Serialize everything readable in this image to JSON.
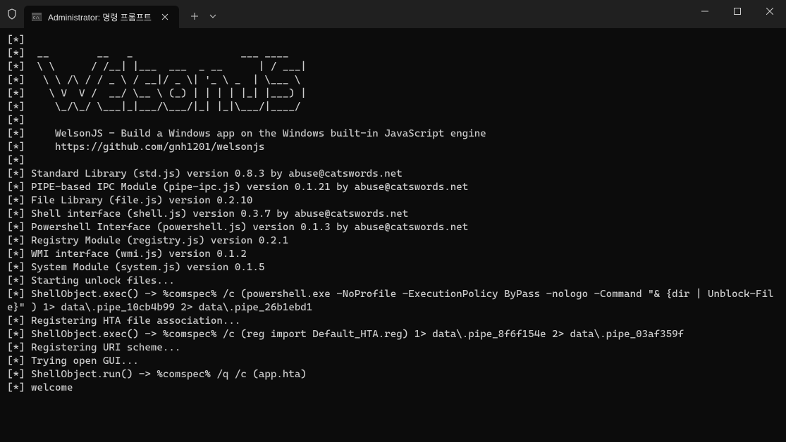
{
  "window": {
    "tab_title": "Administrator: 명령 프롬프트"
  },
  "terminal": {
    "lines": [
      "[*]",
      "[*]  __        __   _                  ___ ____",
      "[*]  \\ \\      / /__| |___  ___  _ __      | / ___|",
      "[*]   \\ \\ /\\ / / _ \\ / __|/ _ \\| '_ \\ _  | \\___ \\",
      "[*]    \\ V  V /  __/ \\__ \\ (_) | | | | |_| |___) |",
      "[*]     \\_/\\_/ \\___|_|___/\\___/|_| |_|\\___/|____/",
      "[*]",
      "[*]     WelsonJS - Build a Windows app on the Windows built-in JavaScript engine",
      "[*]     https://github.com/gnh1201/welsonjs",
      "[*]",
      "[*] Standard Library (std.js) version 0.8.3 by abuse@catswords.net",
      "[*] PIPE-based IPC Module (pipe-ipc.js) version 0.1.21 by abuse@catswords.net",
      "[*] File Library (file.js) version 0.2.10",
      "[*] Shell interface (shell.js) version 0.3.7 by abuse@catswords.net",
      "[*] Powershell Interface (powershell.js) version 0.1.3 by abuse@catswords.net",
      "[*] Registry Module (registry.js) version 0.2.1",
      "[*] WMI interface (wmi.js) version 0.1.2",
      "[*] System Module (system.js) version 0.1.5",
      "[*] Starting unlock files...",
      "[*] ShellObject.exec() -> %comspec% /c (powershell.exe -NoProfile -ExecutionPolicy ByPass -nologo -Command \"& {dir | Unblock-File}\" ) 1> data\\.pipe_10cb4b99 2> data\\.pipe_26b1ebd1",
      "[*] Registering HTA file association...",
      "[*] ShellObject.exec() -> %comspec% /c (reg import Default_HTA.reg) 1> data\\.pipe_8f6f154e 2> data\\.pipe_03af359f",
      "[*] Registering URI scheme...",
      "[*] Trying open GUI...",
      "[*] ShellObject.run() -> %comspec% /q /c (app.hta)",
      "[*] welcome"
    ]
  }
}
